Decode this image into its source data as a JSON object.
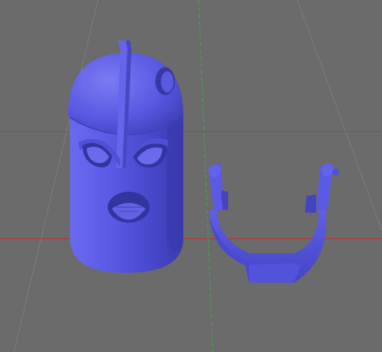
{
  "viewport": {
    "background_color": "#6b6b6b",
    "grid_line_color": "#7d7d7d",
    "horizon_line_color": "#5a5a5a",
    "x_axis_color": "#d41f1f",
    "y_axis_color": "#3fae3f",
    "model_color": "#5555e0",
    "model_shadow_color": "#3b3bb0",
    "model_highlight_color": "#7f7fef"
  },
  "objects": [
    {
      "name": "Mask",
      "icon": "mask-body"
    },
    {
      "name": "Clip",
      "icon": "u-clip"
    }
  ]
}
